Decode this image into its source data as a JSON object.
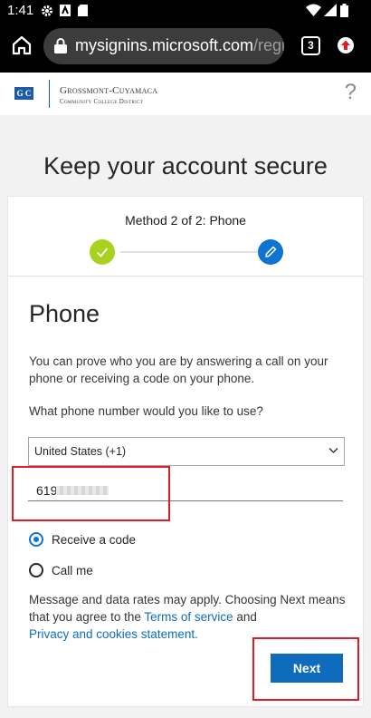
{
  "status_bar": {
    "time": "1:41",
    "icons": [
      "gear-icon",
      "news-icon",
      "sd-card-icon",
      "wifi-icon",
      "signal-icon",
      "battery-icon"
    ]
  },
  "browser": {
    "url_host": "mysignins.microsoft.com",
    "url_path": "/regis",
    "tab_count": "3"
  },
  "org_header": {
    "badge": "G C",
    "name": "Grossmont-Cuyamaca",
    "sub": "Community College District",
    "help": "?"
  },
  "page": {
    "title": "Keep your account secure"
  },
  "progress": {
    "label": "Method 2 of 2: Phone",
    "step_done_color": "#a8d21b",
    "step_current_color": "#0f73d1"
  },
  "form": {
    "section_title": "Phone",
    "description": "You can prove who you are by answering a call on your phone or receiving a code on your phone.",
    "question": "What phone number would you like to use?",
    "country": "United States (+1)",
    "phone_value": "619",
    "options": [
      {
        "label": "Receive a code",
        "selected": true
      },
      {
        "label": "Call me",
        "selected": false
      }
    ],
    "disclaimer_pre": "Message and data rates may apply. Choosing Next means that you agree to the ",
    "terms_link": "Terms of service",
    "disclaimer_and": " and ",
    "privacy_link": "Privacy and cookies statement.",
    "next_label": "Next"
  },
  "colors": {
    "accent": "#0f6cbd",
    "highlight": "#e01b24"
  }
}
